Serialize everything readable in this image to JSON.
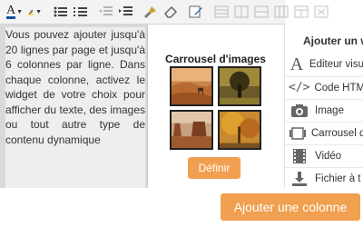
{
  "editor": {
    "text": "Vous pouvez ajouter jusqu'à 20 lignes par page et jusqu'à 6 colonnes par ligne. Dans chaque colonne, activez le widget de votre choix pour afficher du texte, des images ou tout autre type de contenu dynamique"
  },
  "carousel": {
    "title": "Carrousel d'images",
    "define_label": "Définir"
  },
  "panel": {
    "header": "Ajouter un w",
    "items": [
      {
        "label": "Editeur visu",
        "icon": "font-icon"
      },
      {
        "label": "Code HTM",
        "icon": "code-icon"
      },
      {
        "label": "Image",
        "icon": "camera-icon"
      },
      {
        "label": "Carrousel d",
        "icon": "carousel-icon"
      },
      {
        "label": "Vidéo",
        "icon": "film-icon"
      },
      {
        "label": "Fichier à t",
        "icon": "download-icon"
      }
    ]
  },
  "footer": {
    "add_column_label": "Ajouter une colonne"
  },
  "colors": {
    "accent": "#f0a050",
    "editor_bg": "#eeeeee"
  }
}
